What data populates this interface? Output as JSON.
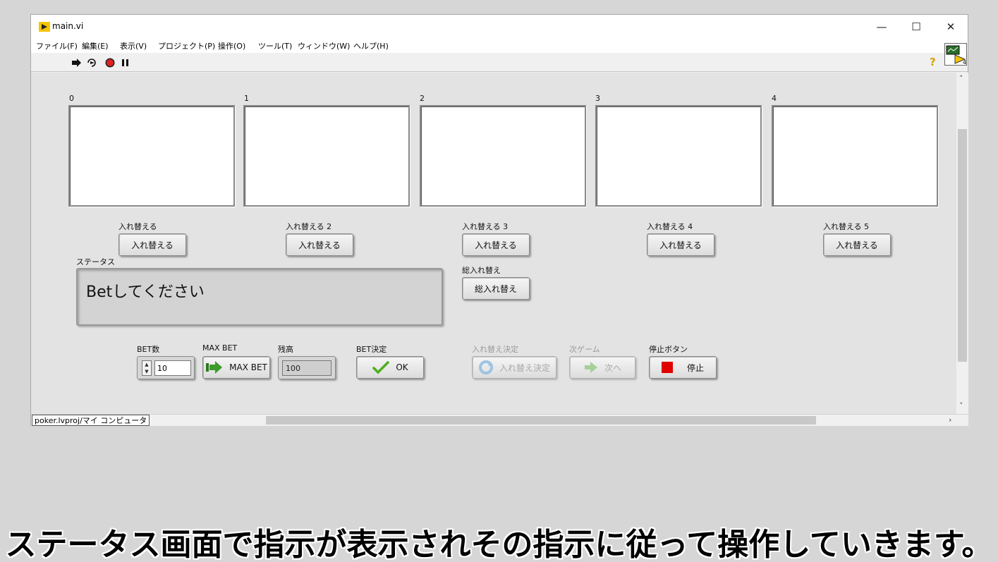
{
  "window": {
    "title": "main.vi",
    "controls": {
      "minimize": "—",
      "maximize": "☐",
      "close": "✕"
    }
  },
  "menu": [
    "ファイル(F)",
    "編集(E)",
    "表示(V)",
    "プロジェクト(P)",
    "操作(O)",
    "ツール(T)",
    "ウィンドウ(W)",
    "ヘルプ(H)"
  ],
  "toolbar": {
    "icons": [
      "run-arrow-icon",
      "run-continuously-icon",
      "abort-icon",
      "pause-icon"
    ],
    "help": "?"
  },
  "cards": [
    {
      "index": "0",
      "label": "入れ替える",
      "button": "入れ替える"
    },
    {
      "index": "1",
      "label": "入れ替える 2",
      "button": "入れ替える"
    },
    {
      "index": "2",
      "label": "入れ替える 3",
      "button": "入れ替える"
    },
    {
      "index": "3",
      "label": "入れ替える 4",
      "button": "入れ替える"
    },
    {
      "index": "4",
      "label": "入れ替える 5",
      "button": "入れ替える"
    }
  ],
  "swap_all": {
    "label": "総入れ替え",
    "button": "総入れ替え"
  },
  "status": {
    "label": "ステータス",
    "value": "Betしてください"
  },
  "bet_count": {
    "label": "BET数",
    "value": "10"
  },
  "max_bet": {
    "label": "MAX BET",
    "button": "MAX BET"
  },
  "balance": {
    "label": "残高",
    "value": "100"
  },
  "bet_confirm": {
    "label": "BET決定",
    "button": "OK"
  },
  "swap_confirm": {
    "label": "入れ替え決定",
    "button": "入れ替え決定"
  },
  "next_game": {
    "label": "次ゲーム",
    "button": "次へ"
  },
  "stop": {
    "label": "停止ボタン",
    "button": "停止"
  },
  "statusbar": {
    "path": "poker.lvproj/マイ コンピュータ"
  },
  "caption": "ステータス画面で指示が表示されその指示に従って操作していきます。",
  "colors": {
    "stop_red": "#e00000",
    "check_green": "#4caf20",
    "arrow_green": "#3c9a2a"
  }
}
